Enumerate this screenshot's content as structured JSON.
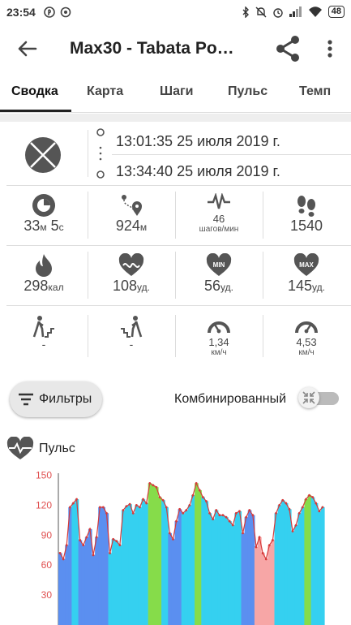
{
  "status_bar": {
    "time": "23:54",
    "battery": "48"
  },
  "app_bar": {
    "title": "Max30 - Tabata Po…"
  },
  "tabs": [
    {
      "label": "Сводка",
      "active": true
    },
    {
      "label": "Карта"
    },
    {
      "label": "Шаги"
    },
    {
      "label": "Пульс"
    },
    {
      "label": "Темп"
    }
  ],
  "times": {
    "start": "13:01:35 25 июля 2019 г.",
    "end": "13:34:40 25 июля 2019 г."
  },
  "stats": {
    "duration": {
      "value": "33",
      "unit1": "м",
      "value2": " 5",
      "unit2": "с"
    },
    "distance": {
      "value": "924",
      "unit": "м"
    },
    "cadence": {
      "value": "46",
      "unit": "шагов/мин"
    },
    "steps": {
      "value": "1540"
    },
    "calories": {
      "value": "298",
      "unit": "кал"
    },
    "hr_avg": {
      "value": "108",
      "unit": "уд."
    },
    "hr_min": {
      "value": "56",
      "unit": "уд."
    },
    "hr_max": {
      "value": "145",
      "unit": "уд."
    },
    "ascent": {
      "value": "-"
    },
    "descent": {
      "value": "-"
    },
    "speed_avg": {
      "value": "1,34",
      "unit": "км/ч"
    },
    "speed_max": {
      "value": "4,53",
      "unit": "км/ч"
    }
  },
  "controls": {
    "filters_label": "Фильтры",
    "combined_label": "Комбинированный",
    "combined_on": false
  },
  "pulse": {
    "title": "Пульс"
  },
  "colors": {
    "zone_blue": "#5b8ff0",
    "zone_cyan": "#35d0f0",
    "zone_green": "#86dc4a",
    "zone_pink": "#f7a6a6",
    "line": "#d63a3a",
    "axis_label": "#e05050"
  },
  "chart_data": {
    "type": "area",
    "title": "Пульс",
    "y_ticks": [
      30,
      60,
      90,
      120,
      150
    ],
    "ylim": [
      0,
      160
    ],
    "values": [
      72,
      66,
      80,
      118,
      122,
      126,
      85,
      80,
      88,
      96,
      70,
      88,
      118,
      118,
      112,
      72,
      86,
      84,
      80,
      115,
      119,
      121,
      112,
      120,
      118,
      126,
      122,
      142,
      140,
      138,
      128,
      125,
      118,
      92,
      86,
      104,
      116,
      112,
      115,
      120,
      130,
      142,
      135,
      128,
      124,
      112,
      106,
      115,
      110,
      110,
      108,
      104,
      100,
      112,
      114,
      92,
      108,
      115,
      110,
      78,
      88,
      72,
      66,
      80,
      85,
      112,
      120,
      125,
      122,
      116,
      94,
      100,
      112,
      118,
      126,
      130,
      128,
      122,
      114,
      118
    ],
    "zones": [
      "blue",
      "blue",
      "blue",
      "blue",
      "cyan",
      "cyan",
      "blue",
      "blue",
      "blue",
      "blue",
      "blue",
      "blue",
      "blue",
      "blue",
      "blue",
      "cyan",
      "cyan",
      "cyan",
      "cyan",
      "cyan",
      "cyan",
      "cyan",
      "cyan",
      "cyan",
      "cyan",
      "cyan",
      "cyan",
      "green",
      "green",
      "green",
      "green",
      "cyan",
      "cyan",
      "blue",
      "blue",
      "blue",
      "blue",
      "cyan",
      "cyan",
      "cyan",
      "cyan",
      "green",
      "green",
      "cyan",
      "cyan",
      "cyan",
      "cyan",
      "cyan",
      "cyan",
      "cyan",
      "cyan",
      "cyan",
      "cyan",
      "cyan",
      "cyan",
      "blue",
      "blue",
      "blue",
      "blue",
      "pink",
      "pink",
      "pink",
      "pink",
      "pink",
      "pink",
      "cyan",
      "cyan",
      "cyan",
      "cyan",
      "cyan",
      "cyan",
      "cyan",
      "cyan",
      "cyan",
      "green",
      "green",
      "cyan",
      "cyan",
      "cyan",
      "cyan"
    ]
  }
}
